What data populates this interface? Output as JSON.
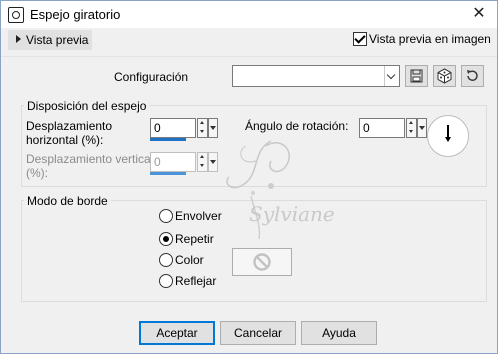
{
  "window": {
    "title": "Espejo giratorio",
    "close_glyph": "✕"
  },
  "preview": {
    "toggle_label": "Vista previa",
    "checkbox_label": "Vista previa en imagen",
    "checkbox_checked": true
  },
  "config": {
    "label": "Configuración",
    "value": ""
  },
  "mirror": {
    "group_label": "Disposición del espejo",
    "h_offset_label_1": "Desplazamiento",
    "h_offset_label_2": "horizontal (%):",
    "h_offset_value": "0",
    "v_offset_label_1": "Desplazamiento vertical",
    "v_offset_label_2": "(%):",
    "v_offset_value": "0",
    "angle_label": "Ángulo de rotación:",
    "angle_value": "0"
  },
  "border": {
    "group_label": "Modo de borde",
    "options": [
      {
        "label": "Envolver",
        "selected": false
      },
      {
        "label": "Repetir",
        "selected": true
      },
      {
        "label": "Color",
        "selected": false
      },
      {
        "label": "Reflejar",
        "selected": false
      }
    ]
  },
  "watermark": {
    "text": "Sylviane"
  },
  "buttons": {
    "ok": "Aceptar",
    "cancel": "Cancelar",
    "help": "Ayuda"
  },
  "colors": {
    "accent": "#0078d7",
    "slider": "#1e73c8"
  }
}
